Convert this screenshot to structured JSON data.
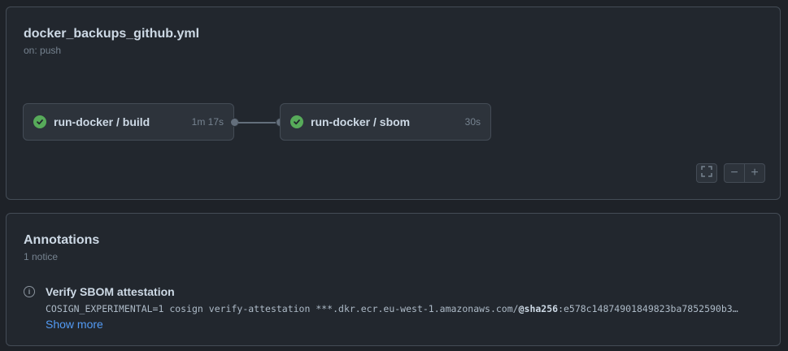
{
  "workflow": {
    "filename": "docker_backups_github.yml",
    "trigger": "on: push",
    "jobs": [
      {
        "name": "run-docker / build",
        "duration": "1m 17s",
        "status": "success"
      },
      {
        "name": "run-docker / sbom",
        "duration": "30s",
        "status": "success"
      }
    ],
    "controls": {
      "zoom_out": "−",
      "zoom_in": "+"
    }
  },
  "annotations": {
    "title": "Annotations",
    "count": "1 notice",
    "items": [
      {
        "level": "notice",
        "title": "Verify SBOM attestation",
        "message_prefix": "COSIGN_EXPERIMENTAL=1 cosign verify-attestation ***.dkr.ecr.eu-west-1.amazonaws.com/",
        "message_bold": "@sha256",
        "message_suffix": ":e578c14874901849823ba7852590b3…",
        "action": "Show more"
      }
    ]
  },
  "colors": {
    "success": "#57ab5a",
    "link": "#539bf5",
    "background": "#22272e"
  }
}
